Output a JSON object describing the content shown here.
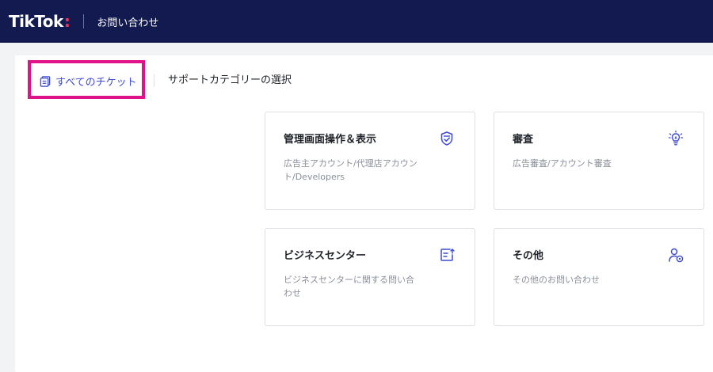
{
  "header": {
    "logo": "TikTok",
    "title": "お問い合わせ"
  },
  "tabs": {
    "all_tickets": "すべてのチケット",
    "select_category": "サポートカテゴリーの選択"
  },
  "cards": [
    {
      "title": "管理画面操作＆表示",
      "desc": "広告主アカウント/代理店アカウント/Developers",
      "icon": "shield-check-icon"
    },
    {
      "title": "審査",
      "desc": "広告審査/アカウント審査",
      "icon": "lightbulb-icon"
    },
    {
      "title": "ビジネスセンター",
      "desc": "ビジネスセンターに関する問い合わせ",
      "icon": "document-arrow-icon"
    },
    {
      "title": "その他",
      "desc": "その他のお問い合わせ",
      "icon": "user-settings-icon"
    }
  ],
  "colors": {
    "header_bg": "#131a4f",
    "accent": "#3d4bd2",
    "highlight": "#e0128a",
    "logo_dot": "#fe2c55"
  }
}
